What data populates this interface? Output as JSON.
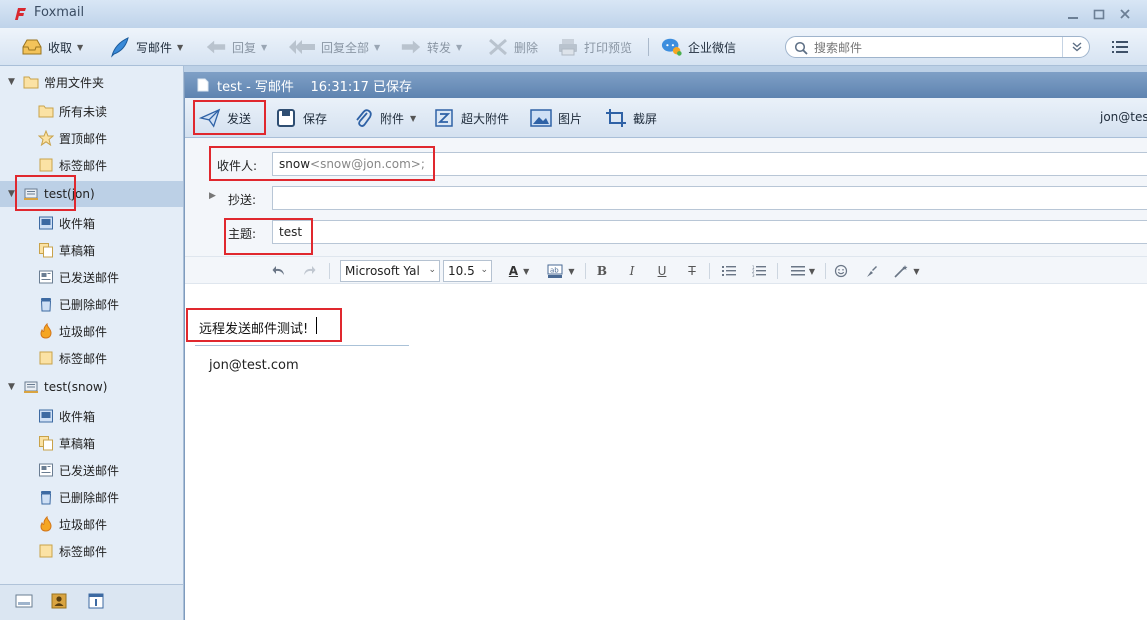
{
  "app": {
    "title": "Foxmail"
  },
  "main_toolbar": {
    "receive": "收取",
    "compose": "写邮件",
    "reply": "回复",
    "reply_all": "回复全部",
    "forward": "转发",
    "delete": "删除",
    "print_preview": "打印预览",
    "wechat_work": "企业微信"
  },
  "search": {
    "placeholder": "搜索邮件"
  },
  "sidebar": {
    "common": {
      "label": "常用文件夹",
      "items": [
        "所有未读",
        "置顶邮件",
        "标签邮件"
      ]
    },
    "accounts": [
      {
        "label": "test(jon)",
        "items": [
          "收件箱",
          "草稿箱",
          "已发送邮件",
          "已删除邮件",
          "垃圾邮件",
          "标签邮件"
        ]
      },
      {
        "label": "test(snow)",
        "items": [
          "收件箱",
          "草稿箱",
          "已发送邮件",
          "已删除邮件",
          "垃圾邮件",
          "标签邮件"
        ]
      }
    ]
  },
  "compose": {
    "title": "test - 写邮件    16:31:17 已保存",
    "toolbar": {
      "send": "发送",
      "save": "保存",
      "attach": "附件",
      "big_attach": "超大附件",
      "image": "图片",
      "screenshot": "截屏"
    },
    "sender": "jon@tes",
    "to_label": "收件人:",
    "to_name": "snow",
    "to_addr": "<snow@jon.com>;",
    "cc_label": "抄送:",
    "subject_label": "主题:",
    "subject_value": "test",
    "format": {
      "font": "Microsoft Yal",
      "size": "10.5"
    },
    "body": "远程发送邮件测试!",
    "signature": "jon@test.com"
  },
  "colors": {
    "accent": "#5e83b0",
    "highlight": "#e0282e"
  }
}
